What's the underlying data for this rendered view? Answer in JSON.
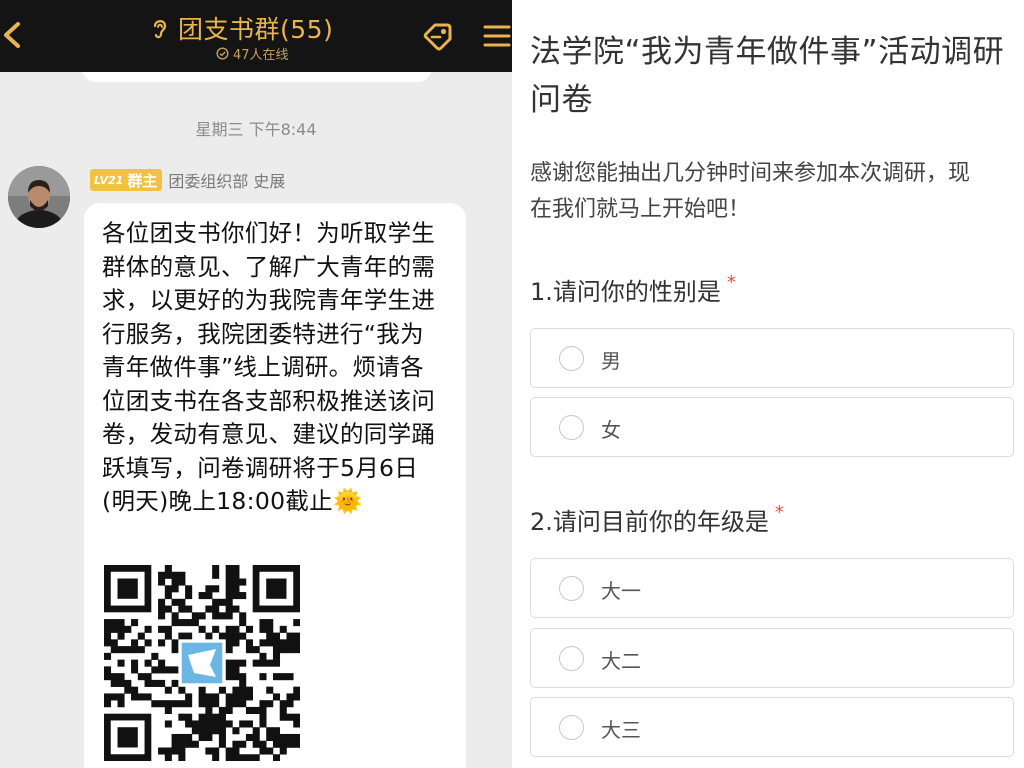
{
  "chat": {
    "header": {
      "group_title": "团支书群(55)",
      "online_count": "47人在线"
    },
    "timestamp": "星期三 下午8:44",
    "message": {
      "level_badge": "LV21",
      "role": "群主",
      "sender": "团委组织部 史展",
      "text": "各位团支书你们好！为听取学生群体的意见、了解广大青年的需求，以更好的为我院青年学生进行服务，我院团委特进行“我为青年做件事”线上调研。烦请各位团支书在各支部积极推送该问卷，发动有意见、建议的同学踊跃填写，问卷调研将于5月6日(明天)晚上18:00截止",
      "emoji": "🌞"
    },
    "colors": {
      "header_bg": "#141414",
      "title_gold": "#e9b44c",
      "badge_gold": "#f2c142"
    }
  },
  "survey": {
    "title": "法学院“我为青年做件事”活动调研问卷",
    "description": "感谢您能抽出几分钟时间来参加本次调研，现在我们就马上开始吧！",
    "questions": [
      {
        "label": "1.请问你的性别是",
        "required_mark": "*",
        "options": [
          "男",
          "女"
        ]
      },
      {
        "label": "2.请问目前你的年级是",
        "required_mark": "*",
        "options": [
          "大一",
          "大二",
          "大三"
        ]
      }
    ],
    "colors": {
      "required": "#e74c3c"
    }
  }
}
